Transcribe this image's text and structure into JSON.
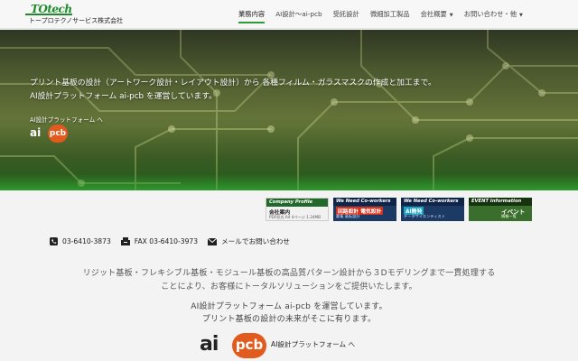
{
  "header": {
    "logo_mark": "TOtech",
    "company_name": "トープロテクノサービス株式会社",
    "nav": [
      {
        "label": "業務内容",
        "active": true,
        "dropdown": false
      },
      {
        "label": "AI設計～ai-pcb",
        "active": false,
        "dropdown": false
      },
      {
        "label": "受託設計",
        "active": false,
        "dropdown": false
      },
      {
        "label": "微細加工製品",
        "active": false,
        "dropdown": false
      },
      {
        "label": "会社概要",
        "active": false,
        "dropdown": true
      },
      {
        "label": "お問い合わせ・他",
        "active": false,
        "dropdown": true
      }
    ]
  },
  "hero": {
    "line1": "プリント基板の設計（アートワーク設計・レイアウト設計）から 各種フィルム・ガラスマスクの作成と加工まで。",
    "line2": "AI設計プラットフォーム ai-pcb を運営しています。",
    "link_label": "AI設計プラットフォーム へ",
    "logo_ai": "ai",
    "logo_pcb": "pcb"
  },
  "banners": [
    {
      "title": "Company Profile",
      "sub": "会社案内",
      "sub2": "PDF形式 A4 4ページ 1.24MB"
    },
    {
      "title": "We Need Co-workers",
      "sub": "回路設計 電気設計",
      "sub2": "募集 基板設計"
    },
    {
      "title": "We Need Co-workers",
      "sub": "AI開発",
      "sub2": "データサイエンティスト"
    },
    {
      "title": "EVENT Information",
      "sub": "イベント",
      "sub2": "情報一覧"
    }
  ],
  "contacts": {
    "phone": "03-6410-3873",
    "fax": "FAX 03-6410-3973",
    "mail": "メールでお問い合わせ"
  },
  "intro": {
    "line1": "リジット基板・フレキシブル基板・モジュール基板の高品質パターン設計から３Dモデリングまで一貫処理する",
    "line2": "ことにより、お客様にトータルソリューションをご提供いたします。",
    "line3": "AI設計プラットフォーム ai-pcb を運営しています。",
    "line4": "プリント基板の設計の未来がそこに有ります。",
    "bottom_link": "AI設計プラットフォーム へ"
  },
  "colors": {
    "accent_green": "#2e9b3a",
    "brand_orange": "#e15a1e"
  }
}
